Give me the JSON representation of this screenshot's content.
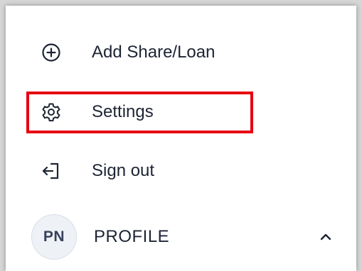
{
  "menu": {
    "items": [
      {
        "label": "Add Share/Loan",
        "icon": "plus-circle-icon"
      },
      {
        "label": "Settings",
        "icon": "gear-icon"
      },
      {
        "label": "Sign out",
        "icon": "sign-out-icon"
      }
    ]
  },
  "profile": {
    "initials": "PN",
    "label": "PROFILE",
    "icon": "chevron-up-icon"
  },
  "colors": {
    "text": "#1d2433",
    "highlight": "#e60012",
    "avatar_bg": "#eef1f6"
  }
}
